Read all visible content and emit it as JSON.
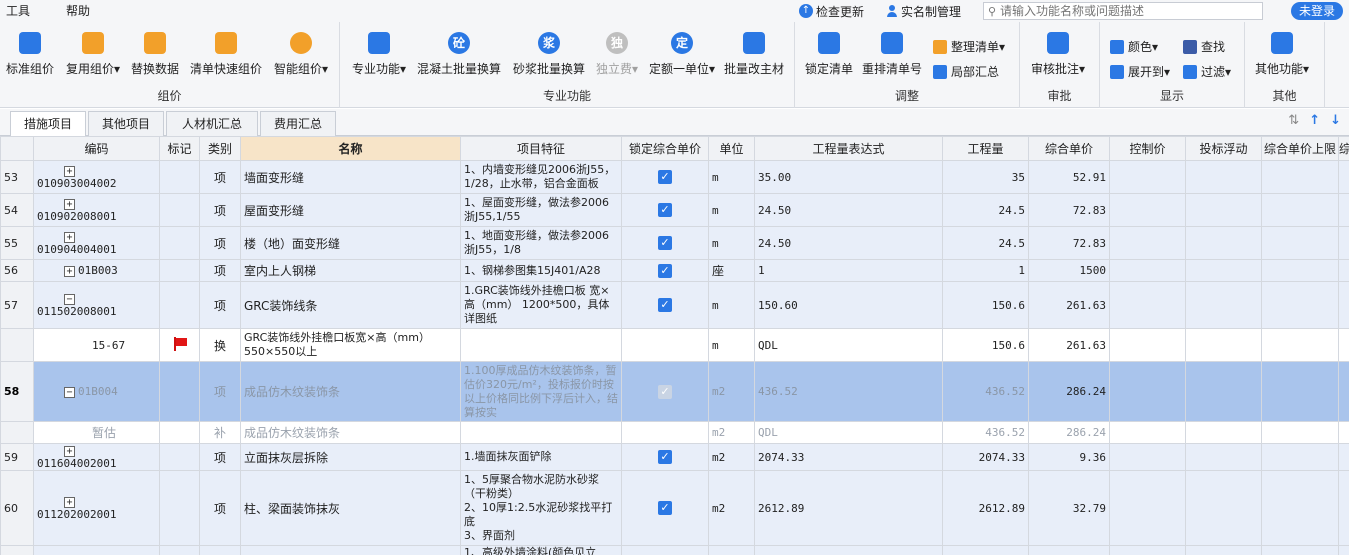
{
  "menu": {
    "tools": "工具",
    "help": "帮助"
  },
  "topbar": {
    "check_update": "检查更新",
    "realname": "实名制管理",
    "search_placeholder": "请输入功能名称或问题描述",
    "login": "未登录"
  },
  "ribbon": {
    "groups": [
      {
        "title": "组价",
        "buttons": [
          "标准组价",
          "复用组价",
          "替换数据",
          "清单快速组价",
          "智能组价"
        ]
      },
      {
        "title": "专业功能",
        "buttons": [
          "专业功能",
          "混凝土批量换算",
          "砂浆批量换算",
          "独立费",
          "定额一单位",
          "批量改主材"
        ]
      },
      {
        "title": "调整",
        "buttons": [
          "锁定清单",
          "重排清单号"
        ],
        "small": [
          "整理清单",
          "局部汇总"
        ]
      },
      {
        "title": "审批",
        "buttons": [
          "审核批注"
        ]
      },
      {
        "title": "显示",
        "small": [
          "颜色",
          "查找",
          "展开到",
          "过滤"
        ]
      },
      {
        "title": "其他",
        "buttons": [
          "其他功能"
        ]
      }
    ],
    "glyphs": {
      "concrete": "砼",
      "mortar": "浆",
      "independent": "独",
      "fixed": "定"
    }
  },
  "tabs": [
    "措施项目",
    "其他项目",
    "人材机汇总",
    "费用汇总"
  ],
  "table": {
    "headers": [
      "编码",
      "标记",
      "类别",
      "名称",
      "项目特征",
      "锁定综合单价",
      "单位",
      "工程量表达式",
      "工程量",
      "综合单价",
      "控制价",
      "投标浮动",
      "综合单价上限",
      "综"
    ],
    "rows": [
      {
        "rn": "53",
        "code": "010903004002",
        "type": "项",
        "name": "墙面变形缝",
        "feature": "1、内墙变形缝见2006浙J55，1/28，止水带，铝合金面板",
        "unit": "m",
        "expr": "35.00",
        "qty": "35",
        "price": "52.91"
      },
      {
        "rn": "54",
        "code": "010902008001",
        "type": "项",
        "name": "屋面变形缝",
        "feature": "1、屋面变形缝，做法参2006浙J55,1/55",
        "unit": "m",
        "expr": "24.50",
        "qty": "24.5",
        "price": "72.83"
      },
      {
        "rn": "55",
        "code": "010904004001",
        "type": "项",
        "name": "楼（地）面变形缝",
        "feature": "1、地面变形缝，做法参2006浙J55，1/8",
        "unit": "m",
        "expr": "24.50",
        "qty": "24.5",
        "price": "72.83"
      },
      {
        "rn": "56",
        "code": "01B003",
        "type": "项",
        "name": "室内上人钢梯",
        "feature": "1、钢梯参图集15J401/A28",
        "unit": "座",
        "expr": "1",
        "qty": "1",
        "price": "1500"
      },
      {
        "rn": "57",
        "code": "011502008001",
        "type": "项",
        "name": "GRC装饰线条",
        "feature": "1.GRC装饰线外挂檐口板 宽×高（mm） 1200*500，具体详图纸",
        "unit": "m",
        "expr": "150.60",
        "qty": "150.6",
        "price": "261.63"
      },
      {
        "rn": "",
        "code": "15-67",
        "type": "换",
        "name": "GRC装饰线外挂檐口板宽×高（mm）550×550以上",
        "feature": "",
        "unit": "m",
        "expr": "QDL",
        "qty": "150.6",
        "price": "261.63"
      },
      {
        "rn": "58",
        "code": "01B004",
        "type": "项",
        "name": "成品仿木纹装饰条",
        "feature": "1.100厚成品仿木纹装饰条，暂估价320元/m²，投标报价时按以上价格同比例下浮后计入，结算按实",
        "unit": "m2",
        "expr": "436.52",
        "qty": "436.52",
        "price": "286.24"
      },
      {
        "rn": "",
        "code": "暂估",
        "type": "补",
        "name": "成品仿木纹装饰条",
        "feature": "",
        "unit": "m2",
        "expr": "QDL",
        "qty": "436.52",
        "price": "286.24"
      },
      {
        "rn": "59",
        "code": "011604002001",
        "type": "项",
        "name": "立面抹灰层拆除",
        "feature": "1.墙面抹灰面铲除",
        "unit": "m2",
        "expr": "2074.33",
        "qty": "2074.33",
        "price": "9.36"
      },
      {
        "rn": "60",
        "code": "011202002001",
        "type": "项",
        "name": "柱、梁面装饰抹灰",
        "feature_lines": [
          "1、5厚聚合物水泥防水砂浆（干粉类）",
          "2、10厚1:2.5水泥砂浆找平打底",
          "3、界面剂"
        ],
        "unit": "m2",
        "expr": "2612.89",
        "qty": "2612.89",
        "price": "32.79"
      },
      {
        "rn": "",
        "code": "",
        "type": "",
        "name": "",
        "feature": "1、高级外墙涂料(颜色见立",
        "unit": "",
        "expr": "",
        "qty": "",
        "price": ""
      }
    ]
  },
  "colors": {
    "accent": "#2b78e4",
    "selected_row": "#a9c4ec",
    "item_row": "#e8eef9",
    "flag": "#e11616"
  }
}
